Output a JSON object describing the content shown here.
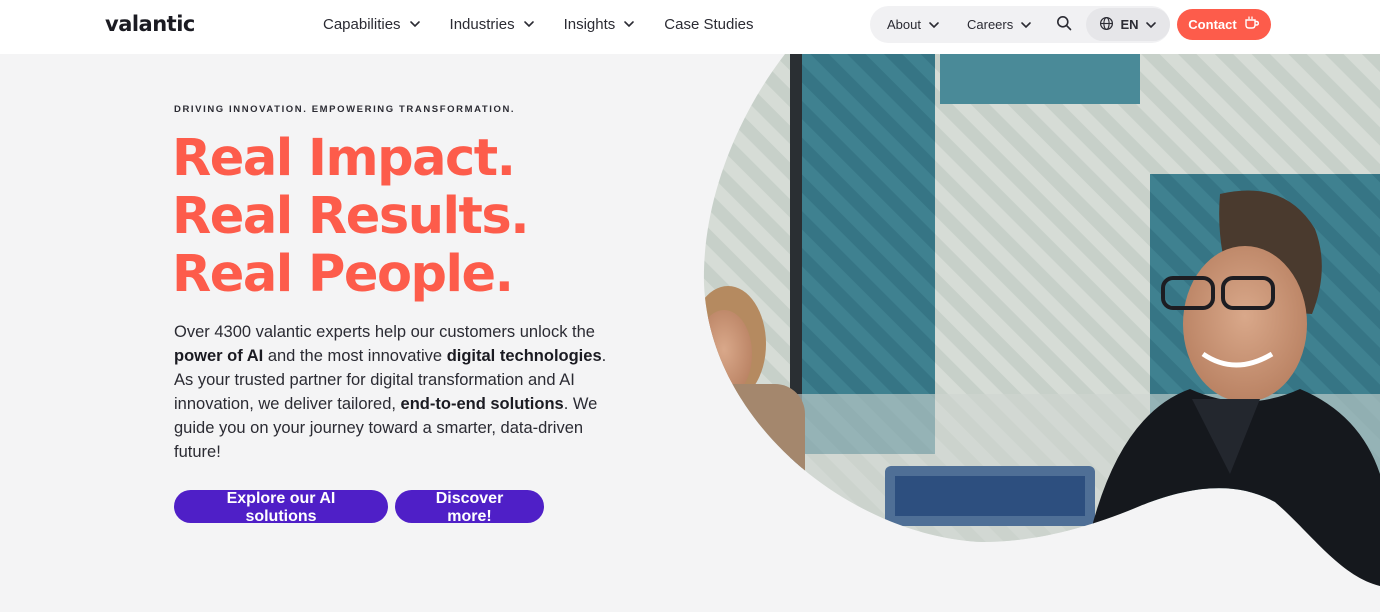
{
  "header": {
    "logo": "valantic",
    "nav": [
      {
        "label": "Capabilities"
      },
      {
        "label": "Industries"
      },
      {
        "label": "Insights"
      },
      {
        "label": "Case Studies"
      }
    ],
    "utility": {
      "about": "About",
      "careers": "Careers",
      "language": "EN"
    },
    "contact": "Contact"
  },
  "hero": {
    "eyebrow": "DRIVING INNOVATION. EMPOWERING TRANSFORMATION.",
    "headline": [
      "Real Impact.",
      "Real Results.",
      "Real People."
    ],
    "intro": {
      "t1": "Over 4300 valantic experts help our customers unlock the ",
      "b1": "power of AI",
      "t2": " and the most innovative ",
      "b2": "digital technologies",
      "t3": ". As your trusted partner for digital transformation and AI innovation, we deliver tailored, ",
      "b3": "end-to-end solutions",
      "t4": ". We guide you on your journey toward a smarter, data-driven future!"
    },
    "cta_primary": "Explore our AI solutions",
    "cta_secondary": "Discover more!"
  },
  "colors": {
    "accent_coral": "#fd5c4b",
    "button_purple": "#4f1fc7",
    "page_bg": "#f4f4f5"
  },
  "icons": [
    "chevron-down-icon",
    "search-icon",
    "globe-icon",
    "coffee-cup-icon"
  ]
}
